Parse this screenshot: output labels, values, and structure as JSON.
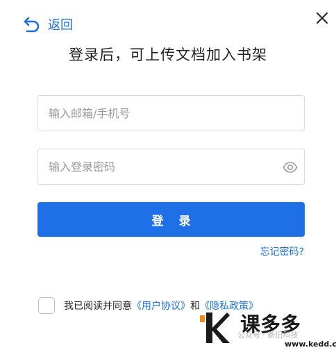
{
  "header": {
    "back_label": "返回",
    "back_icon": "undo-arrow-icon",
    "close_icon": "close-icon"
  },
  "title": "登录后，可上传文档加入书架",
  "form": {
    "email_placeholder": "输入邮箱/手机号",
    "password_placeholder": "输入登录密码",
    "eye_icon": "eye-icon",
    "login_label": "登 录",
    "forgot_label": "忘记密码?"
  },
  "agreement": {
    "prefix": "我已阅读并同意",
    "user_agreement": "《用户协议》",
    "and": "和",
    "privacy_policy": "《隐私政策》"
  },
  "watermark": {
    "text": "公众号 · 新旧科技",
    "brand_name": "课多多",
    "brand_url": "www.kedd.cn"
  },
  "colors": {
    "accent": "#1f70e6",
    "link": "#1f6fd6",
    "border": "#d9d9d9",
    "brand_orange": "#f28a1c"
  }
}
